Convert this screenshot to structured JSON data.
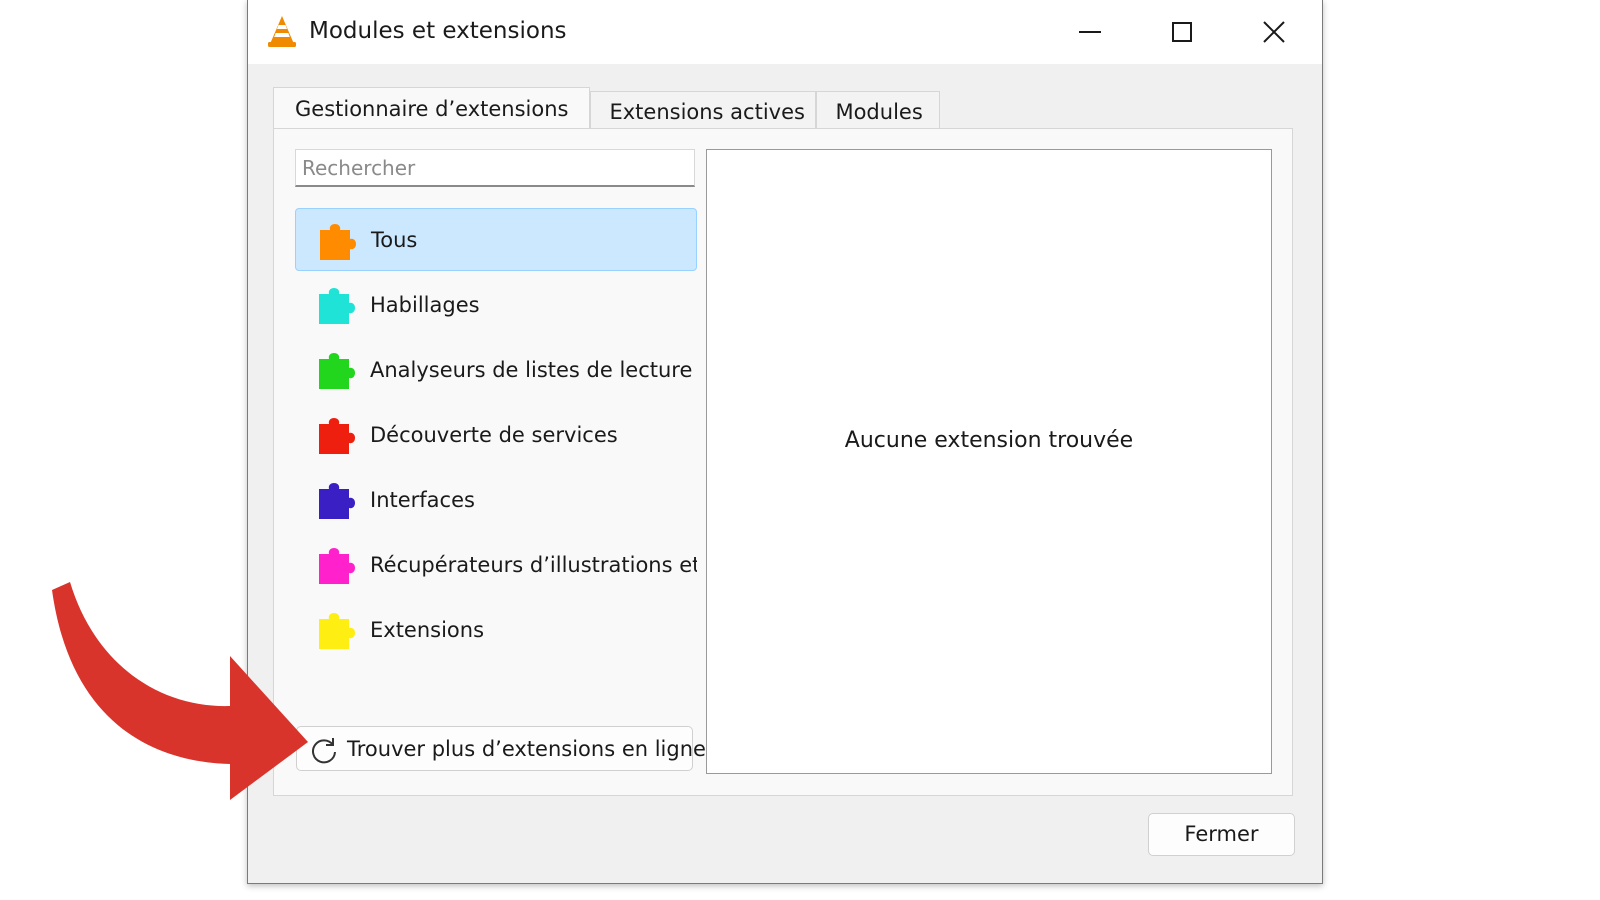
{
  "window": {
    "title": "Modules et extensions",
    "app_icon": "vlc-cone-icon",
    "controls": [
      "minimize-icon",
      "maximize-icon",
      "close-icon"
    ]
  },
  "tabs": [
    {
      "label": "Gestionnaire d’extensions",
      "active": true
    },
    {
      "label": "Extensions actives",
      "active": false
    },
    {
      "label": "Modules",
      "active": false
    }
  ],
  "search": {
    "placeholder": "Rechercher",
    "value": ""
  },
  "categories": [
    {
      "label": "Tous",
      "color": "#ff8c00",
      "selected": true
    },
    {
      "label": "Habillages",
      "color": "#1fe3d6",
      "selected": false
    },
    {
      "label": "Analyseurs de listes de lecture",
      "color": "#22d61e",
      "selected": false
    },
    {
      "label": "Découverte de services",
      "color": "#ef1f10",
      "selected": false
    },
    {
      "label": "Interfaces",
      "color": "#3a1fc4",
      "selected": false
    },
    {
      "label": "Récupérateurs d’illustrations et m",
      "color": "#ff22cc",
      "selected": false
    },
    {
      "label": "Extensions",
      "color": "#ffee11",
      "selected": false
    }
  ],
  "find_button": {
    "label": "Trouver plus d’extensions en ligne",
    "icon": "refresh-icon"
  },
  "extensions_panel": {
    "empty_message": "Aucune extension trouvée"
  },
  "footer": {
    "close_label": "Fermer"
  },
  "colors": {
    "annotation_arrow": "#d9342b",
    "selection_bg": "#cce8ff",
    "vlc_orange": "#f08a00"
  }
}
